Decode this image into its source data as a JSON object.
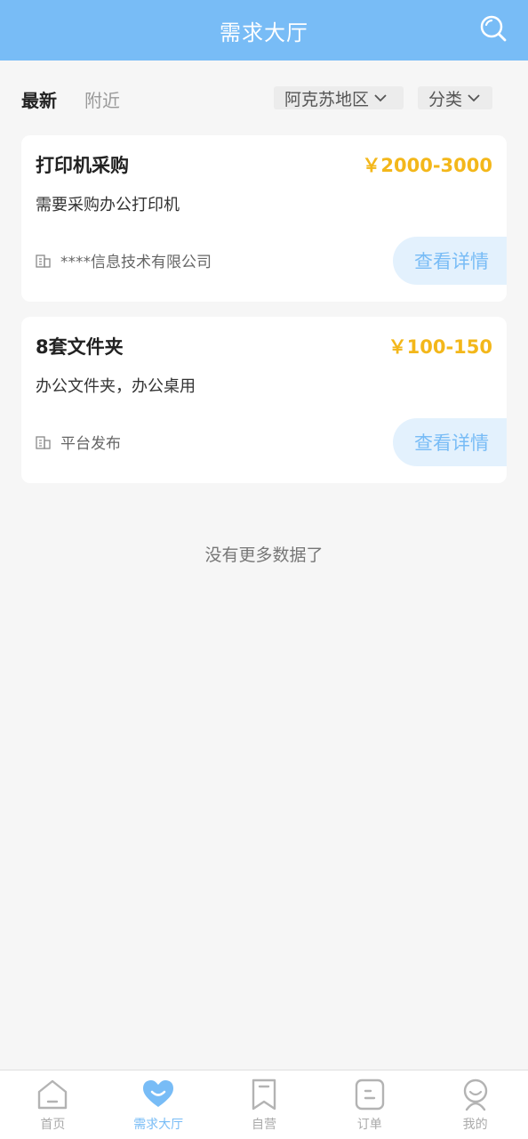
{
  "header": {
    "title": "需求大厅",
    "search_icon": "search-icon"
  },
  "filters": {
    "tabs": [
      {
        "label": "最新",
        "active": true
      },
      {
        "label": "附近",
        "active": false
      }
    ],
    "region": "阿克苏地区",
    "category": "分类"
  },
  "listings": [
    {
      "title": "打印机采购",
      "price": "￥2000-3000",
      "description": "需要采购办公打印机",
      "company": "****信息技术有限公司",
      "button": "查看详情"
    },
    {
      "title": "8套文件夹",
      "price": "￥100-150",
      "description": "办公文件夹，办公桌用",
      "company": "平台发布",
      "button": "查看详情"
    }
  ],
  "no_more": "没有更多数据了",
  "nav": [
    {
      "label": "首页",
      "icon": "home-icon",
      "active": false
    },
    {
      "label": "需求大厅",
      "icon": "heart-icon",
      "active": true
    },
    {
      "label": "自营",
      "icon": "bookmark-icon",
      "active": false
    },
    {
      "label": "订单",
      "icon": "order-icon",
      "active": false
    },
    {
      "label": "我的",
      "icon": "profile-icon",
      "active": false
    }
  ],
  "colors": {
    "primary": "#78bcf6",
    "price": "#f3b71a",
    "background": "#f6f6f6"
  }
}
